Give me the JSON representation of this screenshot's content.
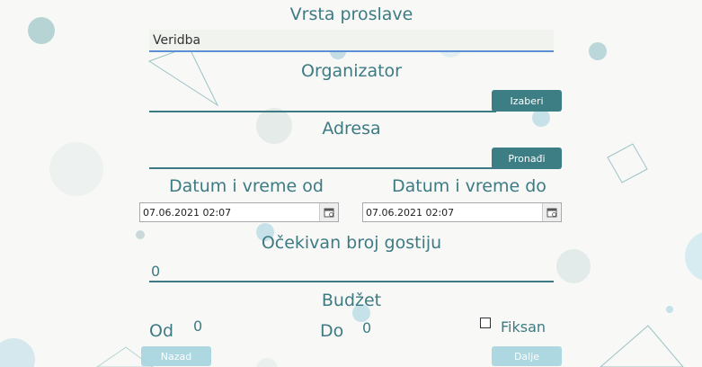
{
  "form": {
    "event_type": {
      "label": "Vrsta proslave",
      "value": "Veridba"
    },
    "organizer": {
      "label": "Organizator",
      "value": "",
      "button": "Izaberi"
    },
    "address": {
      "label": "Adresa",
      "value": "",
      "button": "Pronađi"
    },
    "date_from": {
      "label": "Datum i vreme od",
      "value": "07.06.2021 02:07",
      "icon": "calendar-icon"
    },
    "date_to": {
      "label": "Datum i vreme do",
      "value": "07.06.2021 02:07",
      "icon": "calendar-icon"
    },
    "guests": {
      "label": "Očekivan broj gostiju",
      "value": "0"
    },
    "budget": {
      "label": "Budžet",
      "from_label": "Od",
      "from_value": "0",
      "to_label": "Do",
      "to_value": "0",
      "fixed_label": "Fiksan",
      "fixed_checked": false
    }
  },
  "nav": {
    "back": "Nazad",
    "next": "Dalje"
  },
  "colors": {
    "accent": "#3d7d84",
    "light_button": "#a9d6e0",
    "input_underline": "#5b8fd6"
  }
}
